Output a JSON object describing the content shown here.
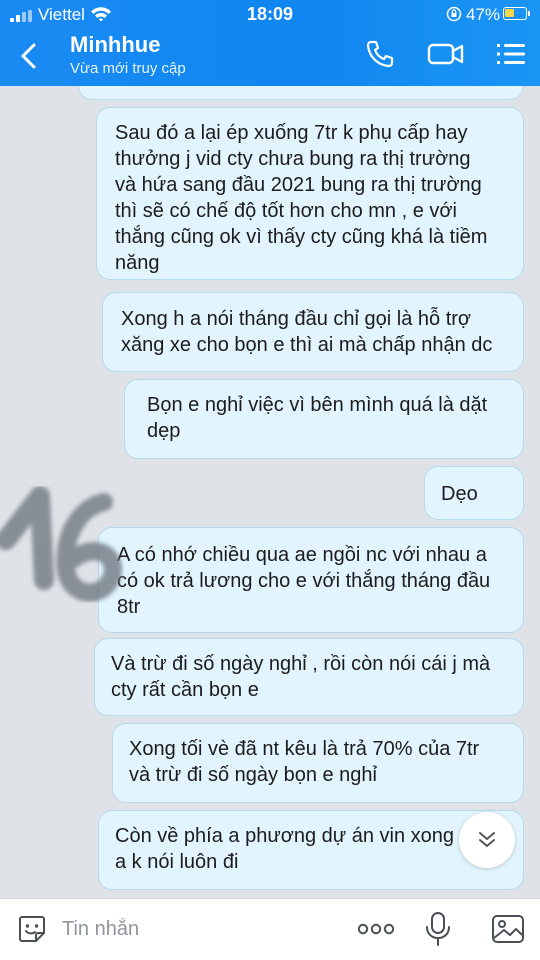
{
  "status_bar": {
    "carrier": "Viettel",
    "time": "18:09",
    "battery_percent": "47%",
    "battery_level": 0.47,
    "battery_color": "#f8d54a"
  },
  "header": {
    "contact_name": "Minhhue",
    "contact_status": "Vừa mới truy cập",
    "back_icon": "chevron-left-icon",
    "call_icon": "phone-icon",
    "video_icon": "video-camera-icon",
    "menu_icon": "list-menu-icon",
    "bar_color": "#1a8bf3"
  },
  "messages": [
    {
      "lines": [
        "Sau đó a lại ép xuống 7tr k phụ cấp hay",
        "thưởng j  vid cty chưa bung ra thị trường",
        "và hứa sang đầu 2021 bung ra thị trường",
        "thì sẽ có chế độ tốt hơn cho mn , e với",
        "thắng cũng ok vì thấy cty cũng khá là tiềm",
        "năng"
      ]
    },
    {
      "lines": [
        "Xong h a nói tháng đầu chỉ gọi là hỗ trợ",
        "xăng xe cho bọn e thì ai mà chấp nhận dc"
      ]
    },
    {
      "lines": [
        "Bọn e nghỉ việc vì bên mình quá là dặt",
        "dẹp"
      ]
    },
    {
      "lines": [
        "Dẹo"
      ]
    },
    {
      "lines": [
        "A có nhớ chiều qua ae ngồi nc với nhau a",
        "có ok trả lương cho e với thắng tháng đầu",
        "8tr"
      ]
    },
    {
      "lines": [
        "Và trừ đi số ngày nghỉ , rồi còn nói cái j mà",
        "cty rất cần bọn e"
      ]
    },
    {
      "lines": [
        "Xong tối vè đã nt kêu là trả 70% của 7tr",
        "và trừ đi số ngày bọn e nghỉ"
      ]
    },
    {
      "lines": [
        "Còn về phía a phương dự án vin xong",
        "a k nói luôn đi"
      ]
    }
  ],
  "watermark": "16",
  "input_bar": {
    "placeholder": "Tin nhắn",
    "emoji_icon": "sticker-smile-icon",
    "more_icon": "more-dots-icon",
    "mic_icon": "microphone-icon",
    "image_icon": "image-icon"
  },
  "scroll_down_icon": "double-chevron-down-icon"
}
